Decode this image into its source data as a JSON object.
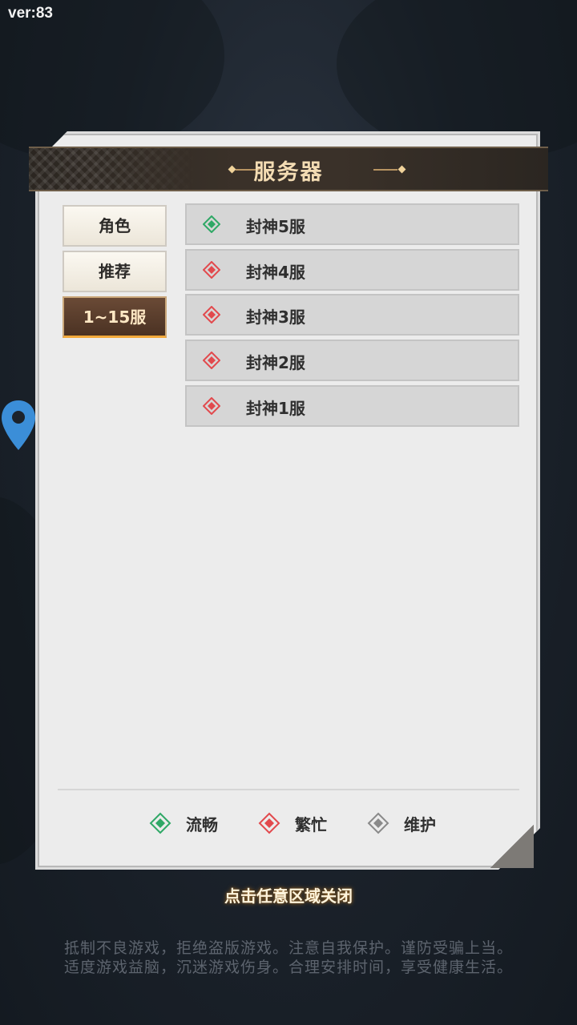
{
  "version": "ver:83",
  "dialog": {
    "title": "服务器",
    "tabs": [
      "角色",
      "推荐",
      "1~15服"
    ],
    "active_tab": 2,
    "servers": [
      {
        "name": "封神5服",
        "status": "流畅",
        "color": "#2fa866"
      },
      {
        "name": "封神4服",
        "status": "繁忙",
        "color": "#e2494d"
      },
      {
        "name": "封神3服",
        "status": "繁忙",
        "color": "#e2494d"
      },
      {
        "name": "封神2服",
        "status": "繁忙",
        "color": "#e2494d"
      },
      {
        "name": "封神1服",
        "status": "繁忙",
        "color": "#e2494d"
      }
    ],
    "legend": [
      {
        "label": "流畅",
        "color": "#2fa866"
      },
      {
        "label": "繁忙",
        "color": "#e2494d"
      },
      {
        "label": "维护",
        "color": "#8a8a8a"
      }
    ]
  },
  "close_hint": "点击任意区域关闭",
  "notice": [
    "抵制不良游戏，拒绝盗版游戏。注意自我保护。谨防受骗上当。",
    "适度游戏益脑，沉迷游戏伤身。合理安排时间，享受健康生活。"
  ],
  "colors": {
    "accent": "#f2a93b",
    "header_text": "#f3dcb3"
  },
  "icons": {
    "map_pin": "map-pin-icon",
    "status": "diamond-status-icon"
  }
}
